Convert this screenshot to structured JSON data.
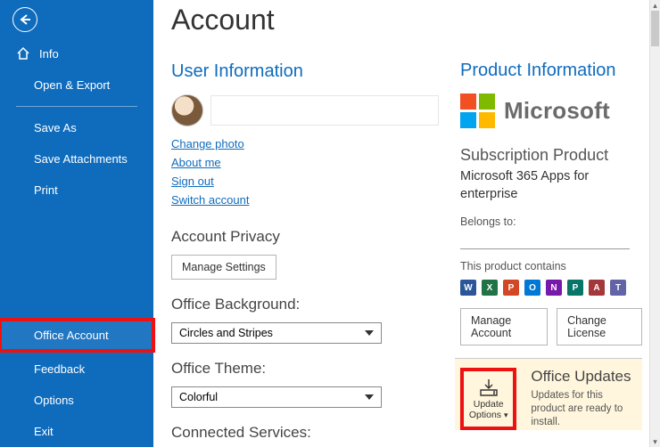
{
  "page": {
    "title": "Account"
  },
  "sidebar": {
    "info": "Info",
    "open_export": "Open & Export",
    "save_as": "Save As",
    "save_attachments": "Save Attachments",
    "print": "Print",
    "office_account": "Office Account",
    "feedback": "Feedback",
    "options": "Options",
    "exit": "Exit"
  },
  "user_info": {
    "heading": "User Information",
    "links": {
      "change_photo": "Change photo",
      "about_me": "About me",
      "sign_out": "Sign out",
      "switch_account": "Switch account"
    }
  },
  "privacy": {
    "heading": "Account Privacy",
    "manage": "Manage Settings"
  },
  "background": {
    "heading": "Office Background:",
    "value": "Circles and Stripes"
  },
  "theme": {
    "heading": "Office Theme:",
    "value": "Colorful"
  },
  "connected": {
    "heading": "Connected Services:"
  },
  "product": {
    "heading": "Product Information",
    "ms": "Microsoft",
    "sub_label": "Subscription Product",
    "sub_name": "Microsoft 365 Apps for enterprise",
    "belongs": "Belongs to:",
    "contains": "This product contains",
    "apps": [
      {
        "letter": "W",
        "color": "#2b579a"
      },
      {
        "letter": "X",
        "color": "#217346"
      },
      {
        "letter": "P",
        "color": "#d24726"
      },
      {
        "letter": "O",
        "color": "#0078d4"
      },
      {
        "letter": "N",
        "color": "#7719aa"
      },
      {
        "letter": "P",
        "color": "#077568"
      },
      {
        "letter": "A",
        "color": "#a4373a"
      },
      {
        "letter": "T",
        "color": "#6264a7"
      }
    ],
    "manage_account": "Manage Account",
    "change_license": "Change License"
  },
  "updates": {
    "btn_label1": "Update",
    "btn_label2": "Options",
    "heading": "Office Updates",
    "desc": "Updates for this product are ready to install."
  }
}
